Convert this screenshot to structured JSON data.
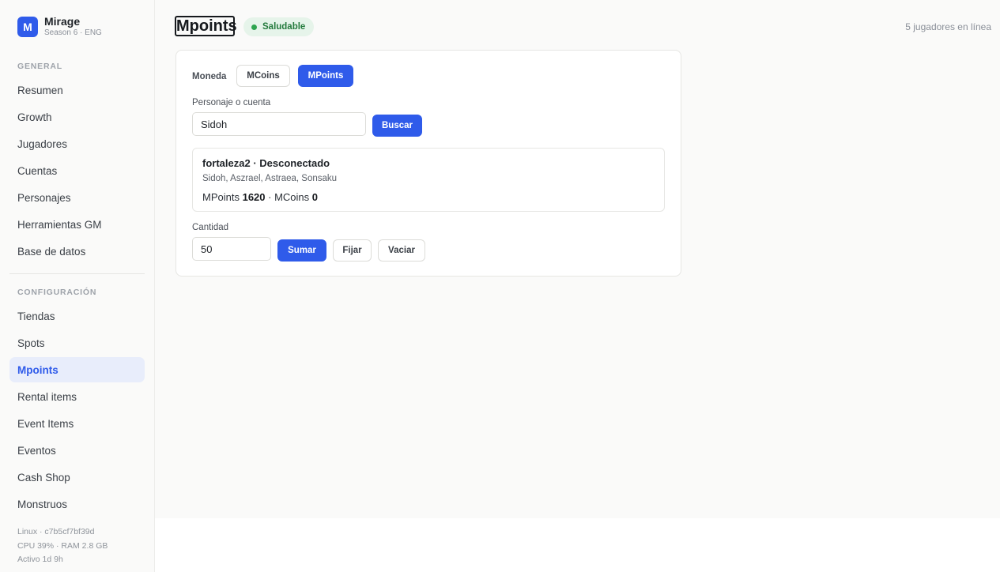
{
  "brand": {
    "logo_letter": "M",
    "name": "Mirage",
    "subtitle": "Season 6 · ENG"
  },
  "sidebar": {
    "general_label": "GENERAL",
    "general_items": [
      "Resumen",
      "Growth",
      "Jugadores",
      "Cuentas",
      "Personajes",
      "Herramientas GM",
      "Base de datos"
    ],
    "config_label": "CONFIGURACIÓN",
    "config_items": [
      "Tiendas",
      "Spots",
      "Mpoints",
      "Rental items",
      "Event Items",
      "Eventos",
      "Cash Shop",
      "Monstruos"
    ],
    "active_item": "Mpoints"
  },
  "system": {
    "host": "Linux · c7b5cf7bf39d",
    "resources": "CPU 39% · RAM 2.8 GB",
    "uptime": "Activo 1d 9h"
  },
  "header": {
    "title": "Mpoints",
    "status": "Saludable",
    "online": "5 jugadores en línea"
  },
  "form": {
    "currency_label": "Moneda",
    "currency_options": [
      "MCoins",
      "MPoints"
    ],
    "currency_selected": "MPoints",
    "search_label": "Personaje o cuenta",
    "search_value": "Sidoh",
    "search_button": "Buscar",
    "amount_label": "Cantidad",
    "amount_value": "50",
    "add_button": "Sumar",
    "set_button": "Fijar",
    "clear_button": "Vaciar"
  },
  "result": {
    "account": "fortaleza2",
    "separator": " · ",
    "status": "Desconectado",
    "characters": "Sidoh, Aszrael, Astraea, Sonsaku",
    "mpoints_label": "MPoints",
    "mpoints_value": "1620",
    "mcoins_label": "MCoins",
    "mcoins_value": "0"
  },
  "colors": {
    "accent": "#2f5bea",
    "success": "#2ea44f",
    "active_bg": "#e8edfb"
  }
}
